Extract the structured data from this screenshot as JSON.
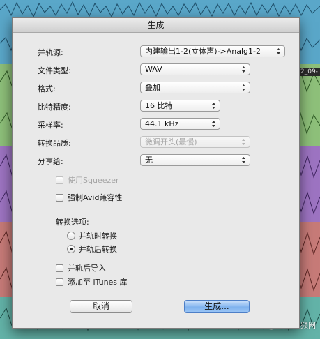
{
  "dialog": {
    "title": "生成",
    "fields": {
      "source": {
        "label": "并轨源:",
        "value": "内建输出1-2(立体声)->Analg1-2"
      },
      "file_type": {
        "label": "文件类型:",
        "value": "WAV"
      },
      "format": {
        "label": "格式:",
        "value": "叠加"
      },
      "bit_depth": {
        "label": "比特精度:",
        "value": "16 比特"
      },
      "sample_rate": {
        "label": "采样率:",
        "value": "44.1 kHz"
      },
      "conversion_quality": {
        "label": "转换品质:",
        "value": "微调开头(最慢)"
      },
      "share_to": {
        "label": "分享给:",
        "value": "无"
      }
    },
    "checkboxes": {
      "use_squeezer": {
        "label": "使用Squeezer",
        "checked": false,
        "enabled": false
      },
      "avid_compat": {
        "label": "强制Avid兼容性",
        "checked": false,
        "enabled": true
      }
    },
    "conversion_options": {
      "label": "转换选项:",
      "during": {
        "label": "并轨时转换",
        "selected": false
      },
      "after": {
        "label": "并轨后转换",
        "selected": true
      }
    },
    "post": {
      "import_after": {
        "label": "并轨后导入",
        "checked": false
      },
      "add_to_itunes": {
        "label": "添加至 iTunes 库",
        "checked": false
      }
    },
    "buttons": {
      "cancel": "取消",
      "bounce": "生成..."
    }
  },
  "background": {
    "track_label": "2_09-",
    "watermark": "中国音频网"
  },
  "colors": {
    "dialog_bg": "#e9e9e9",
    "default_button": "#7fb2ee",
    "track_blue": "#5aa7c9",
    "track_green": "#8ec07a",
    "track_purple": "#9d74c2",
    "track_red": "#c77b78",
    "track_teal": "#63b3a8"
  }
}
